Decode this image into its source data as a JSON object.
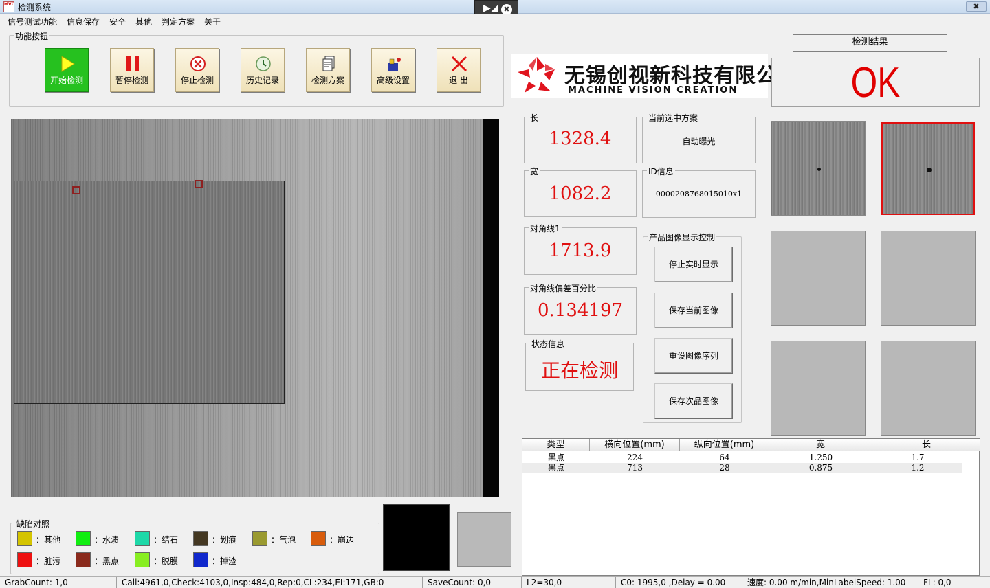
{
  "window": {
    "title": "检测系统",
    "logo_text": "MVC",
    "close_label": "✖",
    "toolbar_pin": "▶◢",
    "toolbar_close": "✖"
  },
  "menu": [
    "信号测试功能",
    "信息保存",
    "安全",
    "其他",
    "判定方案",
    "关于"
  ],
  "function_group": {
    "label": "功能按钮",
    "buttons": [
      {
        "label": "开始检测",
        "icon": "play-icon",
        "active": true
      },
      {
        "label": "暂停检测",
        "icon": "pause-icon"
      },
      {
        "label": "停止检测",
        "icon": "stop-icon"
      },
      {
        "label": "历史记录",
        "icon": "history-icon"
      },
      {
        "label": "检测方案",
        "icon": "document-icon"
      },
      {
        "label": "高级设置",
        "icon": "settings-icon"
      },
      {
        "label": "退 出",
        "icon": "close-icon"
      }
    ]
  },
  "company": {
    "name_cn": "无锡创视新科技有限公司",
    "name_en": "MACHINE VISION CREATION",
    "brand_color": "#e0141e"
  },
  "result": {
    "header": "检测结果",
    "value": "OK",
    "color": "#e00000"
  },
  "measurements": {
    "length": {
      "label": "长",
      "value": "1328.4"
    },
    "width": {
      "label": "宽",
      "value": "1082.2"
    },
    "diagonal": {
      "label": "对角线1",
      "value": "1713.9"
    },
    "diagonal_deviation": {
      "label": "对角线偏差百分比",
      "value": "0.134197"
    },
    "status": {
      "label": "状态信息",
      "value": "正在检测"
    }
  },
  "scheme": {
    "label": "当前选中方案",
    "value": "自动曝光"
  },
  "id_info": {
    "label": "ID信息",
    "value": "0000208768015010x1"
  },
  "display_control": {
    "label": "产品图像显示控制",
    "buttons": [
      "停止实时显示",
      "保存当前图像",
      "重设图像序列",
      "保存次品图像"
    ]
  },
  "defect_table": {
    "columns": [
      "类型",
      "横向位置(mm)",
      "纵向位置(mm)",
      "宽",
      "长"
    ],
    "rows": [
      [
        "黑点",
        "224",
        "64",
        "1.250",
        "1.7"
      ],
      [
        "黑点",
        "713",
        "28",
        "0.875",
        "1.2"
      ]
    ]
  },
  "legend": {
    "label": "缺陷对照",
    "items": [
      {
        "label": "：其他",
        "color": "#d4c400"
      },
      {
        "label": "：水渍",
        "color": "#11ee11"
      },
      {
        "label": "：结石",
        "color": "#1ed8a8"
      },
      {
        "label": "：划痕",
        "color": "#443822"
      },
      {
        "label": "：气泡",
        "color": "#9a9a30"
      },
      {
        "label": "：崩边",
        "color": "#d85c0c"
      },
      {
        "label": "：脏污",
        "color": "#ee1111"
      },
      {
        "label": "：黑点",
        "color": "#8a2a1c"
      },
      {
        "label": "：脱膜",
        "color": "#88ee22"
      },
      {
        "label": "：掉渣",
        "color": "#1028cc"
      }
    ]
  },
  "statusbar": [
    "GrabCount: 1,0",
    "Call:4961,0,Check:4103,0,Insp:484,0,Rep:0,CL:234,EI:171,GB:0",
    "SaveCount: 0,0",
    "L2=30,0",
    "C0: 1995,0 ,Delay = 0.00",
    "速度: 0.00 m/min,MinLabelSpeed: 1.00",
    "FL: 0,0"
  ]
}
